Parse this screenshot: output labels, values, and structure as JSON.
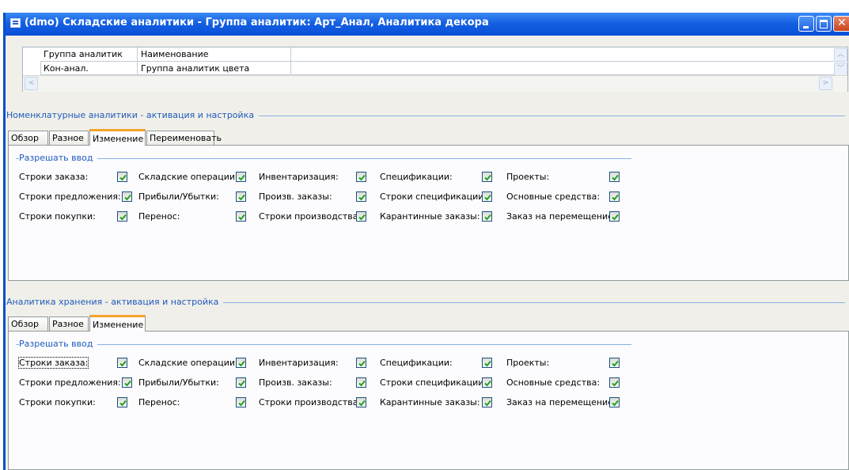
{
  "window": {
    "title": "(dmo) Складские аналитики - Группа аналитик: Арт_Анал, Аналитика декора"
  },
  "grid": {
    "columns": [
      "Группа аналитик",
      "Наименование"
    ],
    "rows": [
      {
        "group": "Кон-анал.",
        "name": "Группа аналитик цвета"
      }
    ]
  },
  "sections": [
    {
      "title": "Номенклатурные аналитики - активация и настройка",
      "tabs": [
        "Обзор",
        "Разное",
        "Изменение",
        "Переименовать"
      ],
      "active_tab": "Изменение",
      "group_label": "Разрешать ввод",
      "rows": [
        [
          {
            "label": "Строки заказа:",
            "checked": true
          },
          {
            "label": "Складские операции:",
            "checked": true
          },
          {
            "label": "Инвентаризация:",
            "checked": true
          },
          {
            "label": "Спецификации:",
            "checked": true
          },
          {
            "label": "Проекты:",
            "checked": true
          }
        ],
        [
          {
            "label": "Строки предложения:",
            "checked": true
          },
          {
            "label": "Прибыли/Убытки:",
            "checked": true
          },
          {
            "label": "Произв. заказы:",
            "checked": true
          },
          {
            "label": "Строки спецификации:",
            "checked": true
          },
          {
            "label": "Основные средства:",
            "checked": true
          }
        ],
        [
          {
            "label": "Строки покупки:",
            "checked": true
          },
          {
            "label": "Перенос:",
            "checked": true
          },
          {
            "label": "Строки производства:",
            "checked": true
          },
          {
            "label": "Карантинные заказы:",
            "checked": true
          },
          {
            "label": "Заказ на перемещение:",
            "checked": true
          }
        ]
      ]
    },
    {
      "title": "Аналитика хранения - активация и настройка",
      "tabs": [
        "Обзор",
        "Разное",
        "Изменение"
      ],
      "active_tab": "Изменение",
      "group_label": "Разрешать ввод",
      "rows": [
        [
          {
            "label": "Строки заказа:",
            "checked": true
          },
          {
            "label": "Складские операции:",
            "checked": true
          },
          {
            "label": "Инвентаризация:",
            "checked": true
          },
          {
            "label": "Спецификации:",
            "checked": true
          },
          {
            "label": "Проекты:",
            "checked": true
          }
        ],
        [
          {
            "label": "Строки предложения:",
            "checked": true
          },
          {
            "label": "Прибыли/Убытки:",
            "checked": true
          },
          {
            "label": "Произв. заказы:",
            "checked": true
          },
          {
            "label": "Строки спецификации:",
            "checked": true
          },
          {
            "label": "Основные средства:",
            "checked": true
          }
        ],
        [
          {
            "label": "Строки покупки:",
            "checked": true
          },
          {
            "label": "Перенос:",
            "checked": true
          },
          {
            "label": "Строки производства:",
            "checked": true
          },
          {
            "label": "Карантинные заказы:",
            "checked": true
          },
          {
            "label": "Заказ на перемещение:",
            "checked": true
          }
        ]
      ]
    }
  ]
}
